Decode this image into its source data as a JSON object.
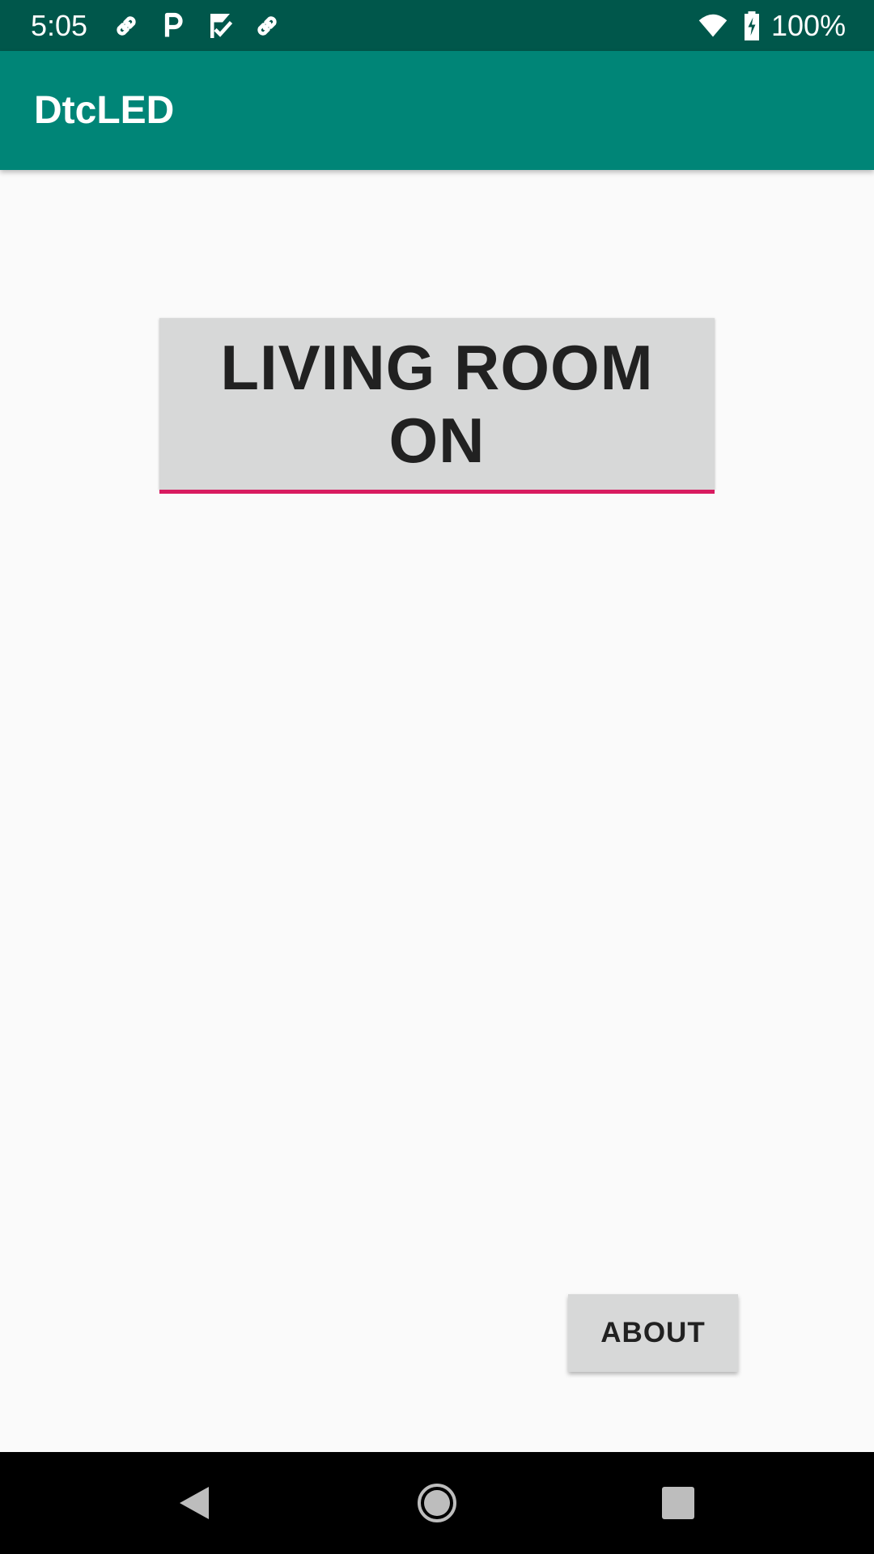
{
  "status_bar": {
    "time": "5:05",
    "battery_percent": "100%",
    "notification_icons": [
      "link-icon",
      "parking-p-icon",
      "check-flag-icon",
      "link-icon"
    ],
    "system_icons": [
      "wifi-icon",
      "battery-charging-icon"
    ]
  },
  "app_bar": {
    "title": "DtcLED",
    "color": "#008577"
  },
  "main": {
    "toggle_button": {
      "label": "LIVING ROOM\nON",
      "indicator_color": "#d81b60"
    },
    "about_button": {
      "label": "ABOUT"
    }
  },
  "nav_bar": {
    "buttons": [
      "back-icon",
      "home-icon",
      "recents-icon"
    ]
  }
}
